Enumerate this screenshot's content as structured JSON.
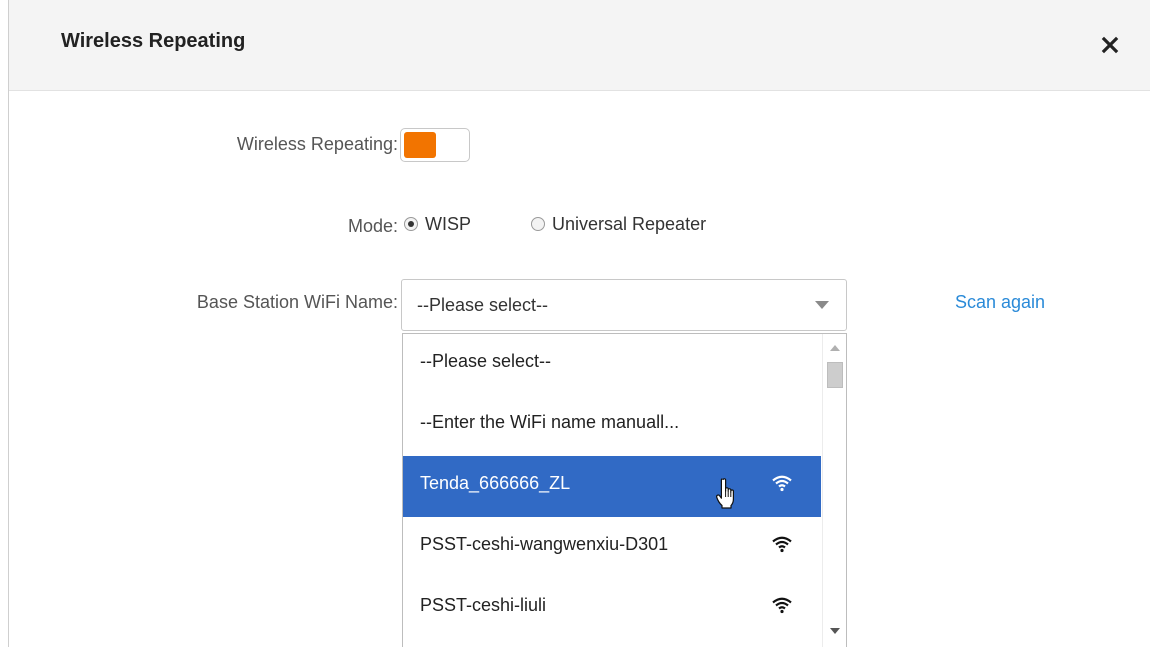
{
  "dialog": {
    "title": "Wireless Repeating",
    "close_icon": "close-icon"
  },
  "form": {
    "repeating_label": "Wireless Repeating:",
    "repeating_enabled": true,
    "mode_label": "Mode:",
    "mode_options": [
      "WISP",
      "Universal Repeater"
    ],
    "mode_selected": "WISP",
    "ssid_label": "Base Station WiFi Name:",
    "ssid_value": "--Please select--",
    "scan_again": "Scan again"
  },
  "dropdown": {
    "options": [
      {
        "label": "--Please select--",
        "icon": ""
      },
      {
        "label": "--Enter the WiFi name manuall...",
        "icon": ""
      },
      {
        "label": "Tenda_666666_ZL",
        "icon": "wifi-icon",
        "selected": true
      },
      {
        "label": "PSST-ceshi-wangwenxiu-D301",
        "icon": "wifi-icon"
      },
      {
        "label": "PSST-ceshi-liuli",
        "icon": "wifi-icon"
      }
    ]
  },
  "colors": {
    "toggle_on": "#f27400",
    "highlight": "#316ac5",
    "link": "#2a8ad8"
  }
}
